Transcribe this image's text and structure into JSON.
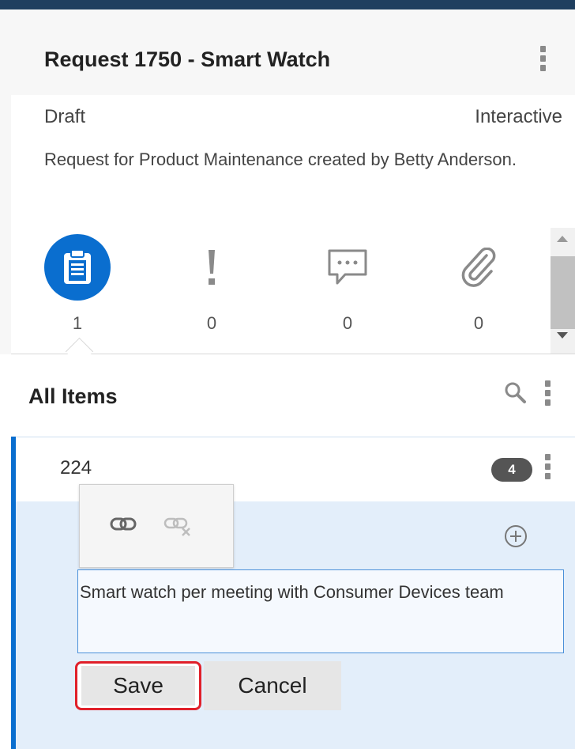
{
  "header": {
    "title": "Request 1750 - Smart Watch",
    "status": "Draft",
    "mode": "Interactive",
    "description": "Request for Product Maintenance created by Betty Anderson."
  },
  "tabs": [
    {
      "name": "items",
      "icon": "clipboard-icon",
      "count": "1",
      "active": true
    },
    {
      "name": "issues",
      "icon": "exclamation-icon",
      "count": "0",
      "active": false
    },
    {
      "name": "comments",
      "icon": "comment-icon",
      "count": "0",
      "active": false
    },
    {
      "name": "attachments",
      "icon": "paperclip-icon",
      "count": "0",
      "active": false
    }
  ],
  "list": {
    "title": "All Items"
  },
  "item": {
    "number": "224",
    "badge_count": "4",
    "description": "Smart watch per meeting with Consumer Devices team"
  },
  "buttons": {
    "save": "Save",
    "cancel": "Cancel"
  },
  "colors": {
    "accent": "#0a6ecf",
    "topbar": "#1f3f5f",
    "highlight_border": "#e0202a",
    "edit_background": "#e3eefa"
  }
}
